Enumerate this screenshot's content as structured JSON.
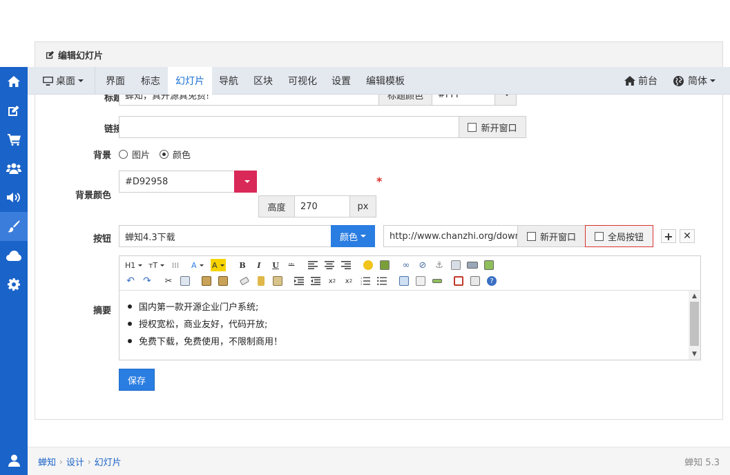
{
  "panel": {
    "title": "编辑幻灯片"
  },
  "navbar": {
    "device": "桌面",
    "items": [
      "界面",
      "标志",
      "幻灯片",
      "导航",
      "区块",
      "可视化",
      "设置",
      "编辑模板"
    ],
    "active": "幻灯片",
    "frontend": "前台",
    "language": "简体"
  },
  "sidebar": {
    "items": [
      "home-icon",
      "edit-icon",
      "cart-icon",
      "users-icon",
      "volume-icon",
      "brush-icon",
      "cloud-icon",
      "gear-icon"
    ],
    "active": "brush-icon",
    "bottom": "user-icon"
  },
  "form": {
    "title_row": {
      "label": "标题",
      "value": "蝉知，真开源真免费!",
      "color_addon": "标题颜色",
      "color_value": "#FFF"
    },
    "link": {
      "label": "链接",
      "value": "",
      "new_window": "新开窗口"
    },
    "background": {
      "label": "背景",
      "options": [
        "图片",
        "颜色"
      ],
      "selected": "颜色"
    },
    "bg_color": {
      "label": "背景颜色",
      "value": "#D92958",
      "swatch": "#d92958",
      "required_mark": "*",
      "height_label": "高度",
      "height_value": "270",
      "height_unit": "px"
    },
    "button": {
      "label": "按钮",
      "text": "蝉知4.3下载",
      "color_button": "颜色",
      "url": "http://www.chanzhi.org/downloa",
      "new_window": "新开窗口",
      "global_button": "全局按钮",
      "add_icon": "plus-icon",
      "remove_icon": "close-icon"
    },
    "summary": {
      "label": "摘要",
      "toolbar": {
        "heading": "H1",
        "font_size": "тT",
        "format_code": "ᴬᴮᶜ"
      },
      "items": [
        "国内第一款开源企业门户系统;",
        "授权宽松，商业友好，代码开放;",
        "免费下载，免费使用，不限制商用！"
      ]
    },
    "save_label": "保存"
  },
  "footer": {
    "breadcrumb": [
      "蝉知",
      "设计",
      "幻灯片"
    ],
    "version": "蝉知 5.3"
  },
  "colors": {
    "sidebar": "#1a63c9",
    "accent": "#2a7de1",
    "swatch": "#d92958",
    "highlight_border": "#d9302c"
  }
}
